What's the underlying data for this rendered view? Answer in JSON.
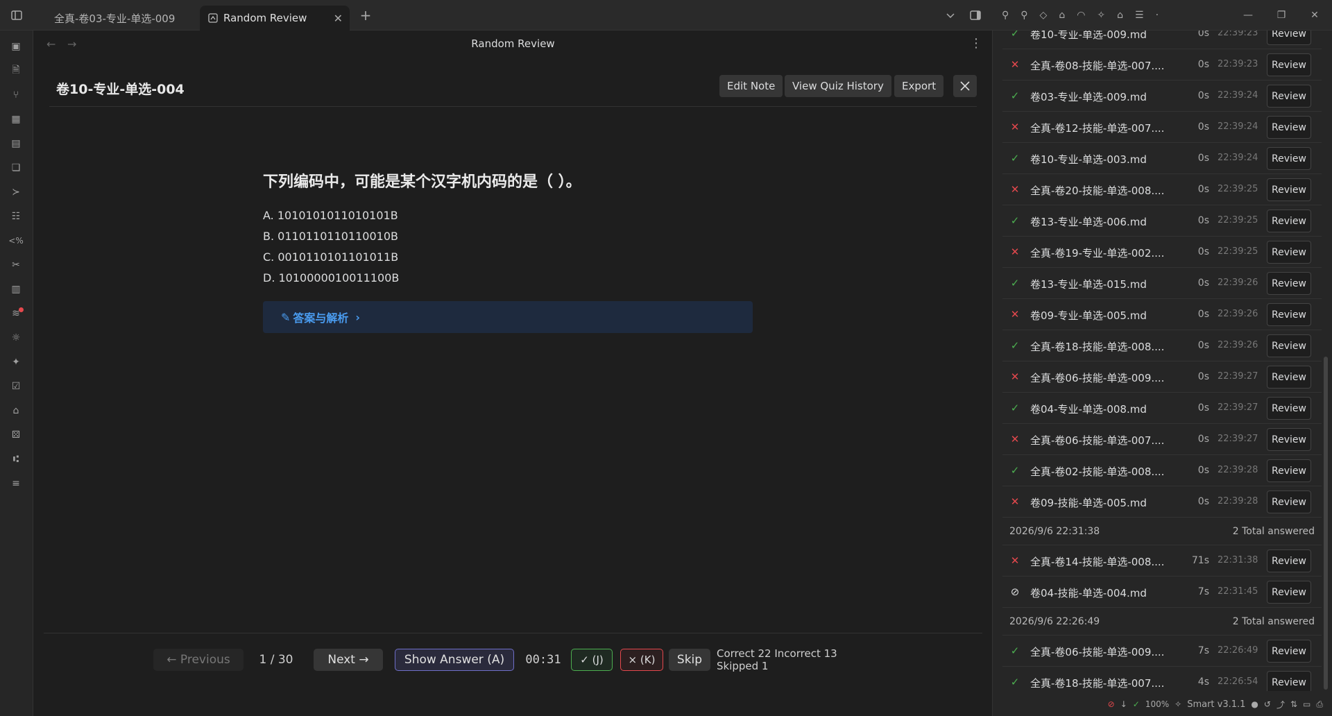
{
  "tabs": [
    {
      "label": "全真-卷03-专业-单选-009"
    },
    {
      "label": "Random Review"
    }
  ],
  "view": {
    "title": "Random Review"
  },
  "note": {
    "title": "卷10-专业-单选-004",
    "buttons": {
      "edit": "Edit Note",
      "history": "View Quiz History",
      "export": "Export"
    }
  },
  "question": {
    "text": "下列编码中，可能是某个汉字机内码的是（ ）。",
    "options": [
      "A. 1010101011010101B",
      "B. 0110110110110010B",
      "C. 0010110101101011B",
      "D. 1010000010011100B"
    ],
    "answer_label": "答案与解析"
  },
  "footer": {
    "previous": "← Previous",
    "progress": "1 / 30",
    "next": "Next →",
    "show_answer": "Show Answer (A)",
    "timer": "00:31",
    "correct_btn": "✓ (J)",
    "incorrect_btn": "× (K)",
    "skip": "Skip",
    "stats": "Correct 22 Incorrect 13 Skipped 1"
  },
  "history": {
    "review_label": "Review",
    "rows": [
      {
        "status": "correct",
        "name": "卷10-专业-单选-009.md",
        "duration": "0s",
        "time": "22:39:23"
      },
      {
        "status": "incorrect",
        "name": "全真-卷08-技能-单选-007....",
        "duration": "0s",
        "time": "22:39:23"
      },
      {
        "status": "correct",
        "name": "卷03-专业-单选-009.md",
        "duration": "0s",
        "time": "22:39:24"
      },
      {
        "status": "incorrect",
        "name": "全真-卷12-技能-单选-007....",
        "duration": "0s",
        "time": "22:39:24"
      },
      {
        "status": "correct",
        "name": "卷10-专业-单选-003.md",
        "duration": "0s",
        "time": "22:39:24"
      },
      {
        "status": "incorrect",
        "name": "全真-卷20-技能-单选-008....",
        "duration": "0s",
        "time": "22:39:25"
      },
      {
        "status": "correct",
        "name": "卷13-专业-单选-006.md",
        "duration": "0s",
        "time": "22:39:25"
      },
      {
        "status": "incorrect",
        "name": "全真-卷19-专业-单选-002....",
        "duration": "0s",
        "time": "22:39:25"
      },
      {
        "status": "correct",
        "name": "卷13-专业-单选-015.md",
        "duration": "0s",
        "time": "22:39:26"
      },
      {
        "status": "incorrect",
        "name": "卷09-专业-单选-005.md",
        "duration": "0s",
        "time": "22:39:26"
      },
      {
        "status": "correct",
        "name": "全真-卷18-技能-单选-008....",
        "duration": "0s",
        "time": "22:39:26"
      },
      {
        "status": "incorrect",
        "name": "全真-卷06-技能-单选-009....",
        "duration": "0s",
        "time": "22:39:27"
      },
      {
        "status": "correct",
        "name": "卷04-专业-单选-008.md",
        "duration": "0s",
        "time": "22:39:27"
      },
      {
        "status": "incorrect",
        "name": "全真-卷06-技能-单选-007....",
        "duration": "0s",
        "time": "22:39:27"
      },
      {
        "status": "correct",
        "name": "全真-卷02-技能-单选-008....",
        "duration": "0s",
        "time": "22:39:28"
      },
      {
        "status": "incorrect",
        "name": "卷09-技能-单选-005.md",
        "duration": "0s",
        "time": "22:39:28"
      }
    ],
    "groups": [
      {
        "date": "2026/9/6 22:31:38",
        "count": "2 Total answered",
        "rows": [
          {
            "status": "incorrect",
            "name": "全真-卷14-技能-单选-008....",
            "duration": "71s",
            "time": "22:31:38"
          },
          {
            "status": "skipped",
            "name": "卷04-技能-单选-004.md",
            "duration": "7s",
            "time": "22:31:45"
          }
        ]
      },
      {
        "date": "2026/9/6 22:26:49",
        "count": "2 Total answered",
        "rows": [
          {
            "status": "correct",
            "name": "全真-卷06-技能-单选-009....",
            "duration": "7s",
            "time": "22:26:49"
          },
          {
            "status": "correct",
            "name": "全真-卷18-技能-单选-007....",
            "duration": "4s",
            "time": "22:26:54"
          }
        ]
      }
    ]
  },
  "statusbar": {
    "zoom": "100%",
    "plugin": "Smart v3.1.1"
  },
  "colors": {
    "correct": "#4caf50",
    "incorrect": "#e5484d",
    "accent": "#4a9cf0"
  }
}
